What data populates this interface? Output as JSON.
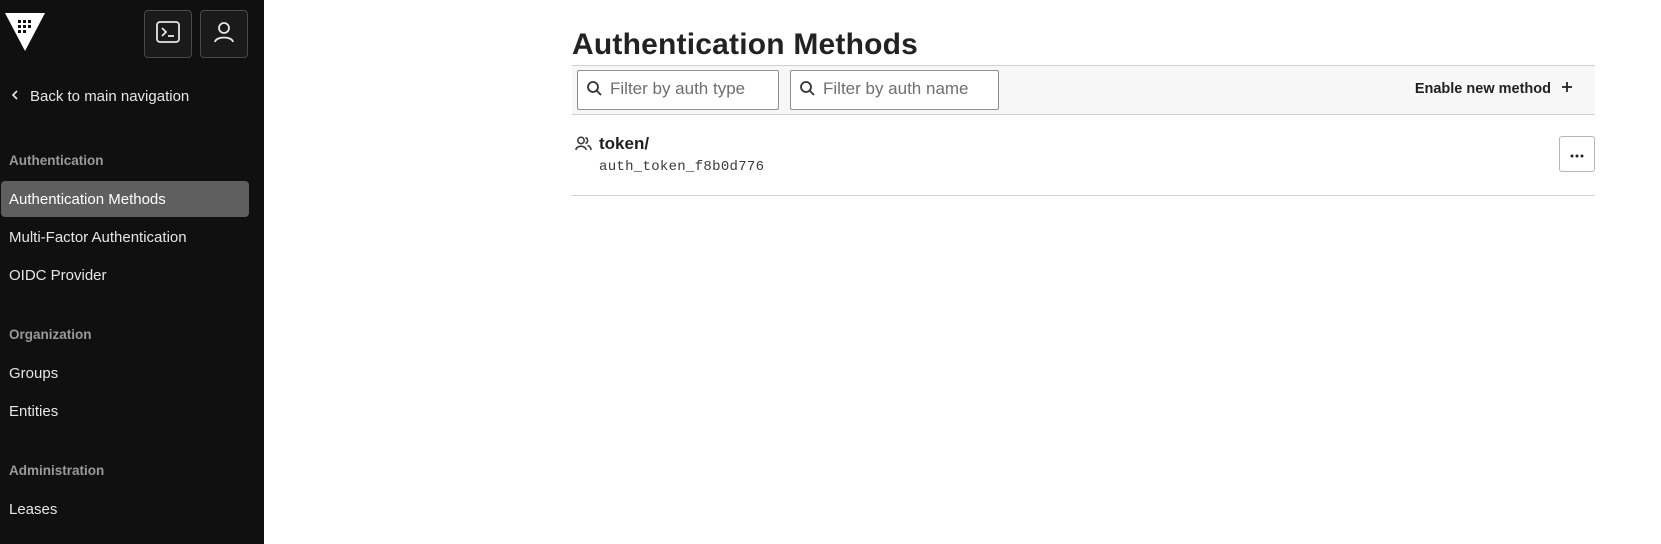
{
  "sidebar": {
    "logo_icon": "vault-logo",
    "console_icon": "terminal-icon",
    "user_icon": "user-icon",
    "back_label": "Back to main navigation",
    "sections": [
      {
        "title": "Authentication",
        "items": [
          {
            "label": "Authentication Methods",
            "active": true
          },
          {
            "label": "Multi-Factor Authentication"
          },
          {
            "label": "OIDC Provider"
          }
        ]
      },
      {
        "title": "Organization",
        "items": [
          {
            "label": "Groups"
          },
          {
            "label": "Entities"
          }
        ]
      },
      {
        "title": "Administration",
        "items": [
          {
            "label": "Leases"
          }
        ]
      }
    ]
  },
  "main": {
    "title": "Authentication Methods",
    "filters": {
      "type_placeholder": "Filter by auth type",
      "name_placeholder": "Filter by auth name"
    },
    "enable_label": "Enable new method",
    "enable_icon": "plus-icon",
    "methods": [
      {
        "path": "token/",
        "accessor": "auth_token_f8b0d776",
        "icon": "users-icon"
      }
    ]
  },
  "colors": {
    "sidebar_bg": "#101010",
    "active_item_bg": "#5f5f60",
    "toolbar_bg": "#f7f7f7"
  }
}
